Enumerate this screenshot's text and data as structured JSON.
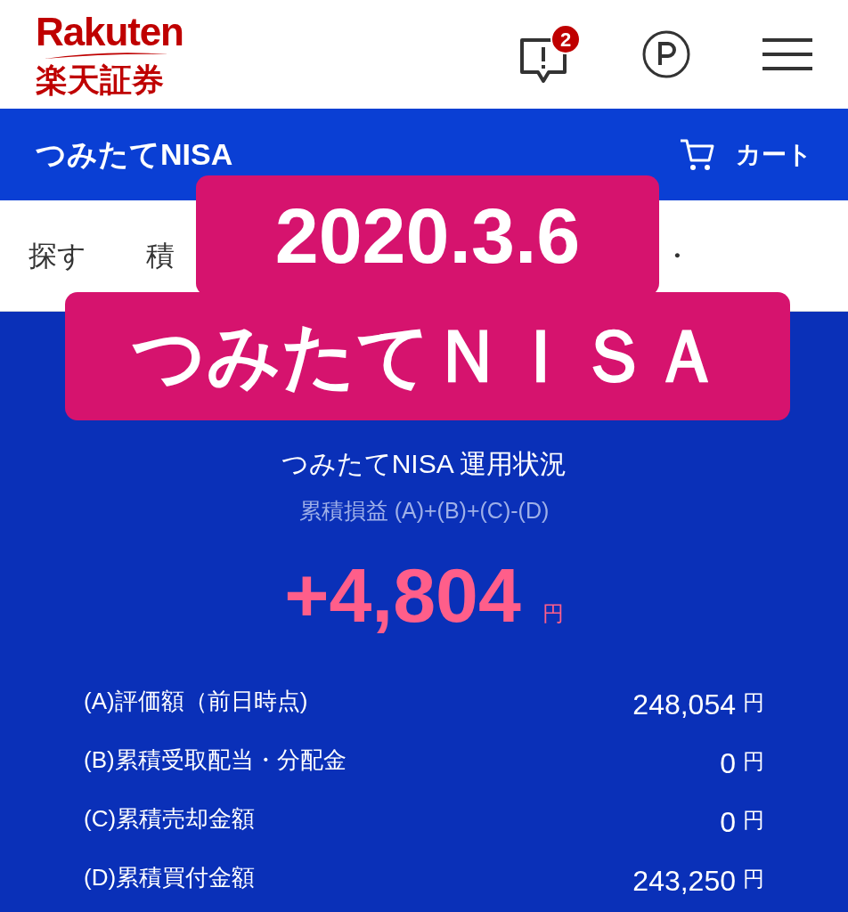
{
  "header": {
    "logo_text": "Rakuten",
    "logo_subtext": "楽天証券",
    "notification_badge": "2"
  },
  "nav_bar": {
    "title": "つみたてNISA",
    "cart_label": "カート"
  },
  "tabs": [
    {
      "label": "探す"
    },
    {
      "label": "積"
    },
    {
      "label": "・"
    }
  ],
  "overlay": {
    "lines": [
      "2020.3.6",
      "つみたてＮＩＳＡ"
    ]
  },
  "summary": {
    "title": "つみたてNISA 運用状況",
    "formula": "累積損益 (A)+(B)+(C)-(D)",
    "total": "+4,804",
    "total_unit": "円"
  },
  "rows": [
    {
      "label": "(A)評価額（前日時点)",
      "value": "248,054",
      "unit": "円"
    },
    {
      "label": "(B)累積受取配当・分配金",
      "value": "0",
      "unit": "円"
    },
    {
      "label": "(C)累積売却金額",
      "value": "0",
      "unit": "円"
    },
    {
      "label": "(D)累積買付金額",
      "value": "243,250",
      "unit": "円"
    }
  ]
}
